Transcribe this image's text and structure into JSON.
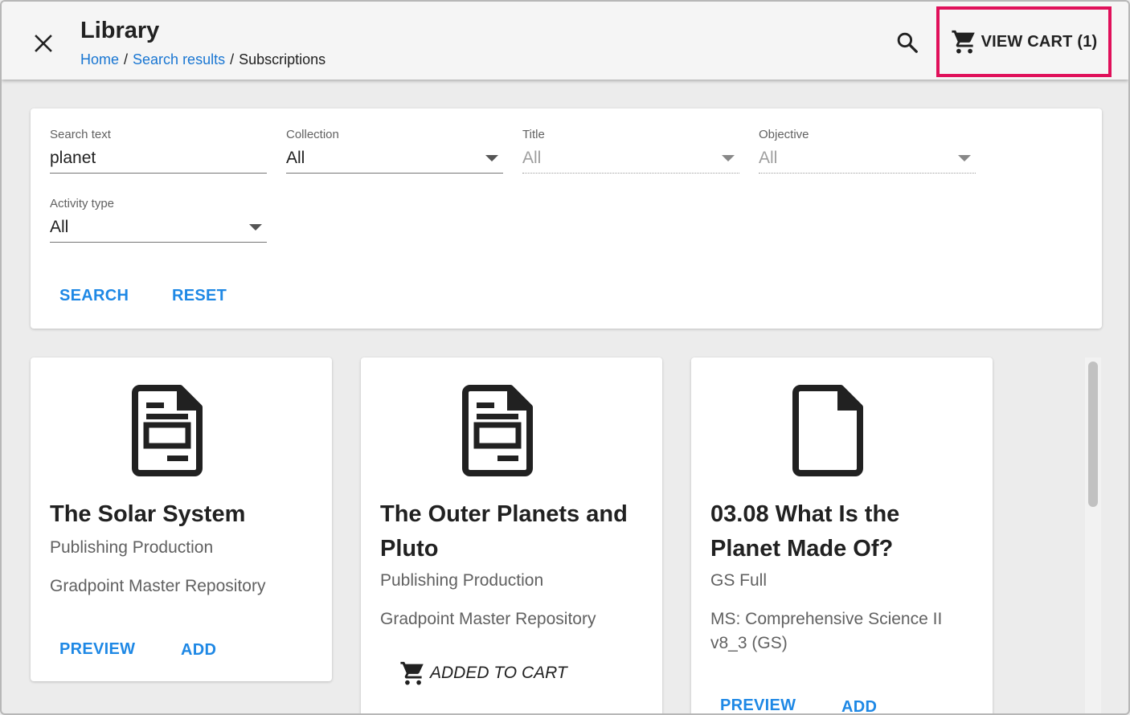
{
  "header": {
    "title": "Library",
    "breadcrumb": {
      "home": "Home",
      "sep1": "/",
      "search_results": "Search results",
      "sep2": "/",
      "current": "Subscriptions"
    },
    "close_icon": "close-icon",
    "search_icon": "search-icon",
    "cart_label": "VIEW CART (1)",
    "cart_highlight_color": "#e0105a"
  },
  "filters": {
    "search_text": {
      "label": "Search text",
      "value": "planet"
    },
    "collection": {
      "label": "Collection",
      "value": "All"
    },
    "title": {
      "label": "Title",
      "value": "All"
    },
    "objective": {
      "label": "Objective",
      "value": "All"
    },
    "activity_type": {
      "label": "Activity type",
      "value": "All"
    },
    "search_button": "SEARCH",
    "reset_button": "RESET"
  },
  "results": [
    {
      "title": "The Solar System",
      "publisher": "Publishing Production",
      "repository": "Gradpoint Master Repository",
      "preview": "PREVIEW",
      "add": "ADD",
      "icon": "document-form-icon"
    },
    {
      "title": "The Outer Planets and Pluto",
      "publisher": "Publishing Production",
      "repository": "Gradpoint Master Repository",
      "status": "ADDED TO CART",
      "icon": "document-form-icon"
    },
    {
      "title": "03.08 What Is the Planet Made Of?",
      "publisher": "GS Full",
      "repository": "MS: Comprehensive Science II v8_3 (GS)",
      "preview": "PREVIEW",
      "add": "ADD",
      "icon": "blank-document-icon"
    }
  ],
  "colors": {
    "accent": "#1e88e5",
    "link": "#1976d2",
    "highlight": "#e0105a"
  }
}
